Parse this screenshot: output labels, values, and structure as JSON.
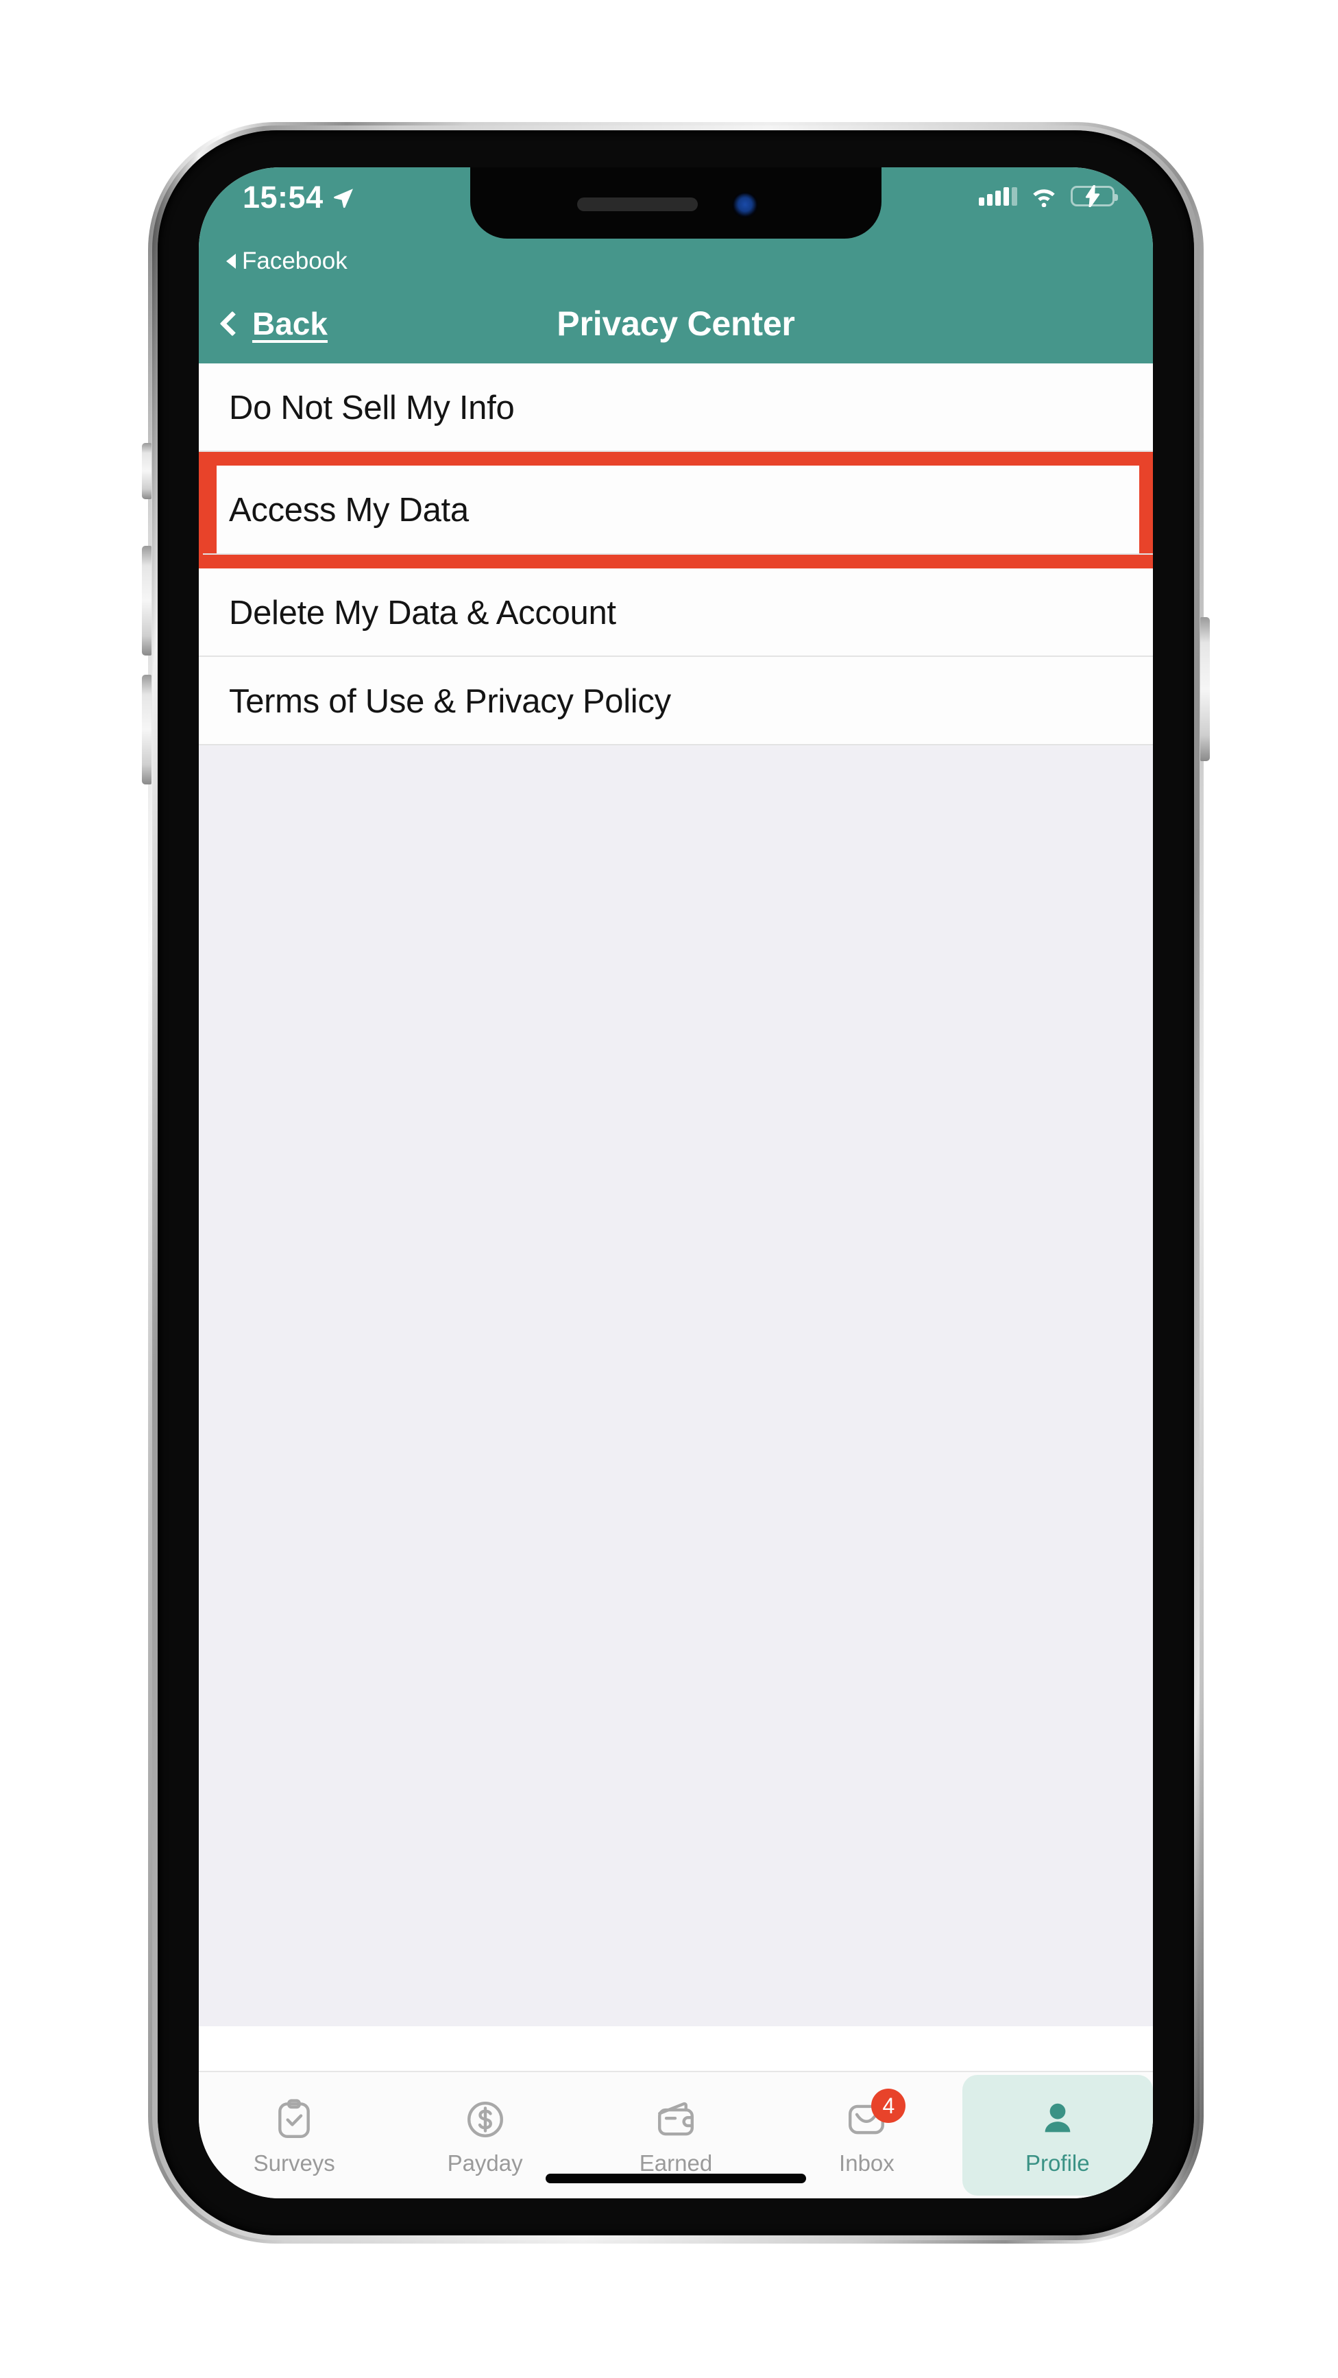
{
  "statusbar": {
    "time": "15:54",
    "location_icon": "location-arrow-icon",
    "signal_icon": "cellular-signal-icon",
    "wifi_icon": "wifi-icon",
    "battery_icon": "battery-charging-icon",
    "battery_color": "#4CD95E"
  },
  "return_bar": {
    "back_triangle_icon": "triangle-left-icon",
    "app_label": "Facebook"
  },
  "navbar": {
    "back_chevron_icon": "chevron-left-icon",
    "back_label": "Back",
    "title": "Privacy Center",
    "background_color": "#46968B"
  },
  "list": {
    "items": [
      {
        "label": "Do Not Sell My Info",
        "highlighted": false
      },
      {
        "label": "Access My Data",
        "highlighted": true
      },
      {
        "label": "Delete My Data & Account",
        "highlighted": false
      },
      {
        "label": "Terms of Use & Privacy Policy",
        "highlighted": false
      }
    ],
    "highlight_color": "#E8432A"
  },
  "tabbar": {
    "active_index": 4,
    "active_color": "#3A9285",
    "active_background": "#DCEEE9",
    "inactive_color": "#9A9A9A",
    "items": [
      {
        "label": "Surveys",
        "icon": "clipboard-check-icon",
        "badge": ""
      },
      {
        "label": "Payday",
        "icon": "dollar-coin-icon",
        "badge": ""
      },
      {
        "label": "Earned",
        "icon": "wallet-icon",
        "badge": ""
      },
      {
        "label": "Inbox",
        "icon": "envelope-icon",
        "badge": "4"
      },
      {
        "label": "Profile",
        "icon": "person-icon",
        "badge": ""
      }
    ]
  }
}
